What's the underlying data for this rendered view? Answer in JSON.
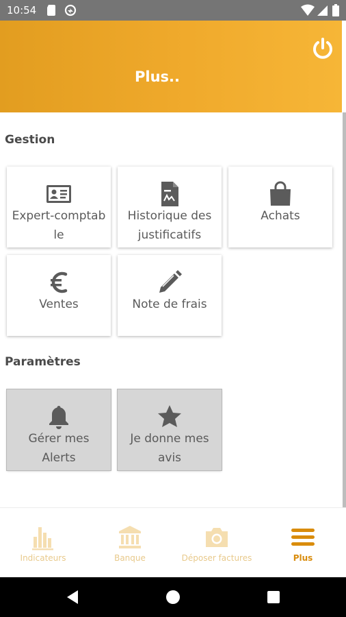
{
  "status_bar": {
    "time": "10:54"
  },
  "header": {
    "title": "Plus.."
  },
  "sections": {
    "gestion": {
      "title": "Gestion"
    },
    "parametres": {
      "title": "Paramètres"
    }
  },
  "tiles": {
    "expert": {
      "line1": "Expert-comptab",
      "line2": "le",
      "icon": "id-card-icon"
    },
    "historique": {
      "line1": "Historique des",
      "line2": "justificatifs",
      "icon": "document-icon"
    },
    "achats": {
      "line1": "Achats",
      "icon": "shopping-bag-icon"
    },
    "ventes": {
      "line1": "Ventes",
      "icon": "euro-icon"
    },
    "frais": {
      "line1": "Note de frais",
      "icon": "pencil-icon"
    },
    "alerts": {
      "line1": "Gérer mes",
      "line2": "Alerts",
      "icon": "bell-icon"
    },
    "avis": {
      "line1": "Je donne mes",
      "line2": "avis",
      "icon": "star-icon"
    }
  },
  "bottom_nav": {
    "indicateurs": {
      "label": "Indicateurs",
      "icon": "bar-chart-icon"
    },
    "banque": {
      "label": "Banque",
      "icon": "bank-icon"
    },
    "deposer": {
      "label": "Déposer factures",
      "icon": "camera-icon"
    },
    "plus": {
      "label": "Plus",
      "icon": "menu-icon",
      "active": true
    }
  },
  "colors": {
    "accent": "#f0aa2c",
    "accent_dark": "#d98c0c",
    "nav_inactive": "#f5deb0",
    "tile_text": "#5a5a5a"
  }
}
